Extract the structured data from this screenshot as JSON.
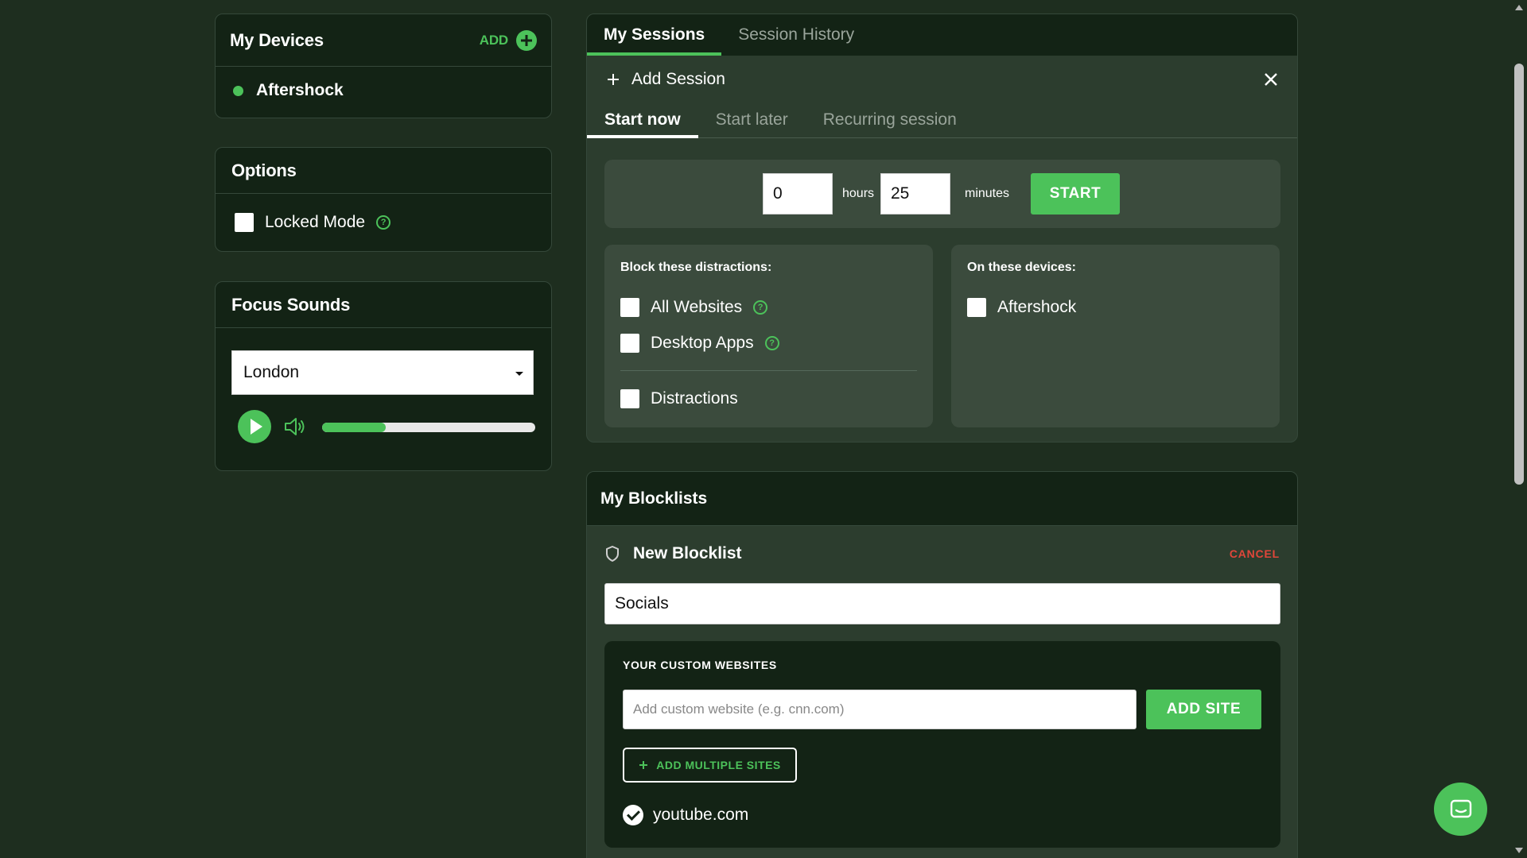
{
  "devices": {
    "title": "My Devices",
    "add_label": "ADD",
    "items": [
      {
        "name": "Aftershock",
        "status_color": "#4cc25a"
      }
    ]
  },
  "options": {
    "title": "Options",
    "locked_mode_label": "Locked Mode",
    "locked_mode_checked": false
  },
  "focus_sounds": {
    "title": "Focus Sounds",
    "selected_sound": "London",
    "volume_fraction": 0.3
  },
  "sessions": {
    "tabs": [
      {
        "label": "My Sessions",
        "active": true
      },
      {
        "label": "Session History",
        "active": false
      }
    ],
    "add_session_label": "Add Session",
    "subtabs": [
      {
        "label": "Start now",
        "active": true
      },
      {
        "label": "Start later",
        "active": false
      },
      {
        "label": "Recurring session",
        "active": false
      }
    ],
    "hours_value": "0",
    "hours_unit": "hours",
    "minutes_value": "25",
    "minutes_unit": "minutes",
    "start_label": "START",
    "distractions": {
      "title": "Block these distractions:",
      "items": [
        "All Websites",
        "Desktop Apps"
      ],
      "extra": "Distractions"
    },
    "devices": {
      "title": "On these devices:",
      "items": [
        "Aftershock"
      ]
    }
  },
  "blocklists": {
    "title": "My Blocklists",
    "new_label": "New Blocklist",
    "cancel_label": "CANCEL",
    "name_value": "Socials",
    "custom_title": "YOUR CUSTOM WEBSITES",
    "site_placeholder": "Add custom website (e.g. cnn.com)",
    "add_site_label": "ADD SITE",
    "add_multiple_label": "ADD MULTIPLE SITES",
    "sites": [
      "youtube.com"
    ]
  },
  "colors": {
    "accent": "#4cc25a",
    "danger": "#e0463a",
    "background": "#1e2e1f",
    "card": "#132315"
  }
}
